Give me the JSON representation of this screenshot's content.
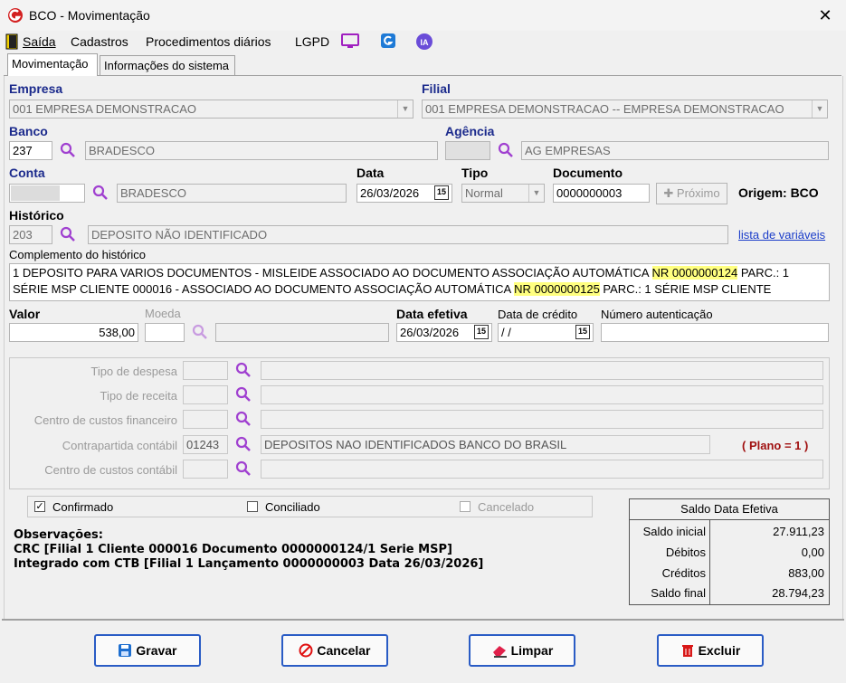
{
  "window": {
    "title": "BCO - Movimentação",
    "close": "✕"
  },
  "menu": [
    "Saída",
    "Cadastros",
    "Procedimentos diários",
    "LGPD"
  ],
  "tabs": [
    "Movimentação",
    "Informações do sistema"
  ],
  "empresa": {
    "label": "Empresa",
    "value": "001 EMPRESA DEMONSTRACAO"
  },
  "filial": {
    "label": "Filial",
    "value": "001 EMPRESA DEMONSTRACAO -- EMPRESA DEMONSTRACAO"
  },
  "banco": {
    "label": "Banco",
    "code": "237",
    "name": "BRADESCO"
  },
  "agencia": {
    "label": "Agência",
    "code": "",
    "name": "AG EMPRESAS"
  },
  "conta": {
    "label": "Conta",
    "code": "",
    "name": "BRADESCO"
  },
  "data": {
    "label": "Data",
    "value": "26/03/2026"
  },
  "tipo": {
    "label": "Tipo",
    "value": "Normal"
  },
  "documento": {
    "label": "Documento",
    "value": "0000000003",
    "next_label": "Próximo"
  },
  "origem": "Origem: BCO",
  "historico": {
    "label": "Histórico",
    "code": "203",
    "text": "DEPOSITO NÃO IDENTIFICADO",
    "link": "lista de variáveis"
  },
  "complemento": {
    "label": "Complemento do histórico",
    "line1_a": "1 DEPOSITO PARA VARIOS DOCUMENTOS - MISLEIDE ASSOCIADO AO DOCUMENTO ASSOCIAÇÃO AUTOMÁTICA ",
    "line1_hl": "NR 0000000124",
    "line1_b": " PARC.: 1",
    "line2_a": "SÉRIE MSP CLIENTE 000016 -  ASSOCIADO AO DOCUMENTO ASSOCIAÇÃO AUTOMÁTICA ",
    "line2_hl": "NR 0000000125",
    "line2_b": " PARC.: 1 SÉRIE MSP CLIENTE"
  },
  "valor": {
    "label": "Valor",
    "value": "538,00"
  },
  "moeda": {
    "label": "Moeda",
    "code": "",
    "name": ""
  },
  "data_efetiva": {
    "label": "Data efetiva",
    "value": "26/03/2026"
  },
  "data_credito": {
    "label": "Data de crédito",
    "value": " / /"
  },
  "numero_autenticacao": {
    "label": "Número autenticação",
    "value": ""
  },
  "contabil": {
    "tipo_despesa": {
      "label": "Tipo de despesa",
      "code": "",
      "name": ""
    },
    "tipo_receita": {
      "label": "Tipo de receita",
      "code": "",
      "name": ""
    },
    "centro_financeiro": {
      "label": "Centro de custos financeiro",
      "code": "",
      "name": ""
    },
    "contrapartida": {
      "label": "Contrapartida contábil",
      "code": "01243",
      "name": "DEPOSITOS NAO IDENTIFICADOS BANCO DO BRASIL"
    },
    "centro_contabil": {
      "label": "Centro de custos contábil",
      "code": "",
      "name": ""
    },
    "plano": "( Plano = 1 )"
  },
  "checks": {
    "confirmado": {
      "label": "Confirmado",
      "checked": true
    },
    "conciliado": {
      "label": "Conciliado",
      "checked": false
    },
    "cancelado": {
      "label": "Cancelado",
      "checked": false
    }
  },
  "saldo": {
    "title": "Saldo Data Efetiva",
    "rows": [
      {
        "label": "Saldo inicial",
        "value": "27.911,23"
      },
      {
        "label": "Débitos",
        "value": "0,00"
      },
      {
        "label": "Créditos",
        "value": "883,00"
      },
      {
        "label": "Saldo final",
        "value": "28.794,23"
      }
    ]
  },
  "observacoes": {
    "title": "Observações:",
    "line1": "CRC [Filial 1 Cliente 000016 Documento 0000000124/1 Serie MSP]",
    "line2": "Integrado com CTB [Filial 1 Lançamento 0000000003 Data 26/03/2026]"
  },
  "buttons": {
    "gravar": "Gravar",
    "cancelar": "Cancelar",
    "limpar": "Limpar",
    "excluir": "Excluir"
  },
  "icons": {
    "search": "magnifier-icon",
    "calendar": "calendar-icon",
    "calendar_text": "15",
    "accent": "#a040d0"
  }
}
